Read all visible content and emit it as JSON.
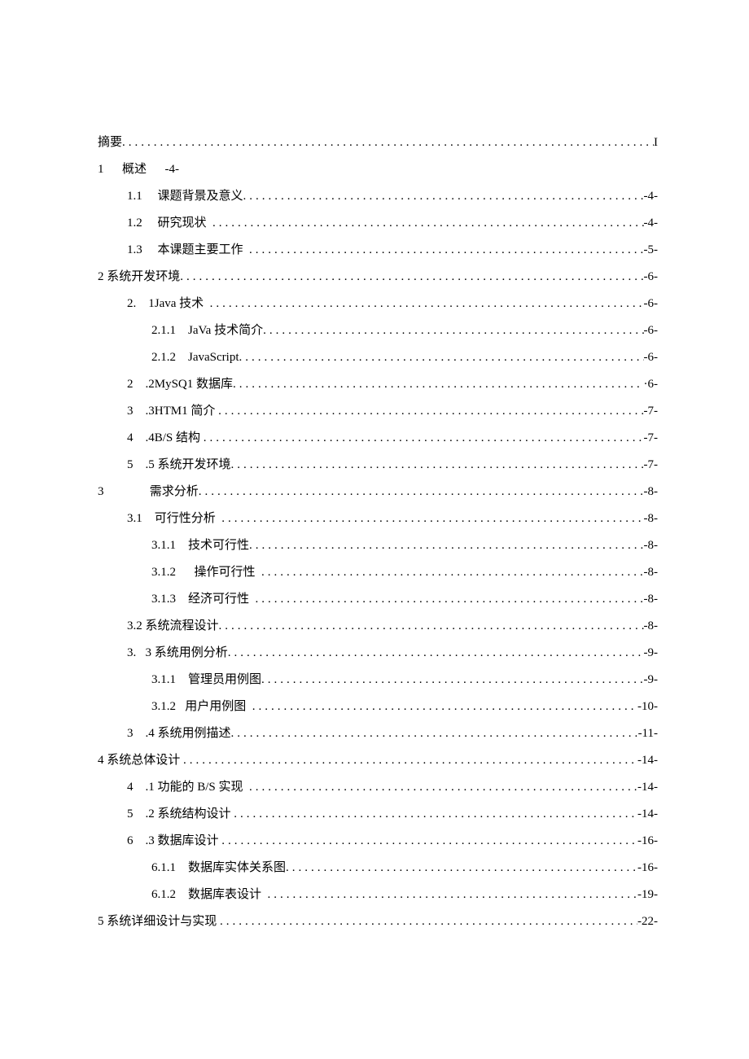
{
  "toc": [
    {
      "indent": 0,
      "label": "摘要",
      "page": "I",
      "leader": true
    },
    {
      "indent": 0,
      "label": "1      概述      -4-",
      "page": "",
      "leader": false
    },
    {
      "indent": 1,
      "label": "1.1     课题背景及意义",
      "page": "-4-",
      "leader": true
    },
    {
      "indent": 1,
      "label": "1.2     研究现状  ",
      "page": "-4-",
      "leader": true
    },
    {
      "indent": 1,
      "label": "1.3     本课题主要工作  ",
      "page": "-5-",
      "leader": true
    },
    {
      "indent": 0,
      "label": "2 系统开发环境",
      "page": "-6-",
      "leader": true
    },
    {
      "indent": 1,
      "label": "2.    1Java 技术  ",
      "page": "-6-",
      "leader": true
    },
    {
      "indent": 2,
      "label": "2.1.1    JaVa 技术简介",
      "page": "-6-",
      "leader": true
    },
    {
      "indent": 2,
      "label": "2.1.2    JavaScript",
      "page": "-6-",
      "leader": true
    },
    {
      "indent": 1,
      "label": "2    .2MySQ1 数据库",
      "page": " ·6-",
      "leader": true
    },
    {
      "indent": 1,
      "label": "3    .3HTM1 简介 ",
      "page": "-7-",
      "leader": true
    },
    {
      "indent": 1,
      "label": "4    .4B/S 结构 ",
      "page": "-7-",
      "leader": true
    },
    {
      "indent": 1,
      "label": "5    .5 系统开发环境",
      "page": "-7-",
      "leader": true
    },
    {
      "indent": 0,
      "label": "3               需求分析",
      "page": "-8-",
      "leader": true
    },
    {
      "indent": 1,
      "label": "3.1    可行性分析  ",
      "page": "-8-",
      "leader": true
    },
    {
      "indent": 2,
      "label": "3.1.1    技术可行性",
      "page": "-8-",
      "leader": true
    },
    {
      "indent": 2,
      "label": "3.1.2      操作可行性  ",
      "page": "-8-",
      "leader": true
    },
    {
      "indent": 2,
      "label": "3.1.3    经济可行性  ",
      "page": "-8-",
      "leader": true
    },
    {
      "indent": 1,
      "label": "3.2 系统流程设计",
      "page": "-8-",
      "leader": true
    },
    {
      "indent": 1,
      "label": "3.   3 系统用例分析",
      "page": "-9-",
      "leader": true
    },
    {
      "indent": 2,
      "label": "3.1.1    管理员用例图",
      "page": "-9-",
      "leader": true
    },
    {
      "indent": 2,
      "label": "3.1.2   用户用例图  ",
      "page": "-10-",
      "leader": true
    },
    {
      "indent": 1,
      "label": "3    .4 系统用例描述",
      "page": "-11-",
      "leader": true
    },
    {
      "indent": 0,
      "label": "4 系统总体设计 ",
      "page": "-14-",
      "leader": true
    },
    {
      "indent": 1,
      "label": "4    .1 功能的 B/S 实现  ",
      "page": "-14-",
      "leader": true
    },
    {
      "indent": 1,
      "label": "5    .2 系统结构设计 ",
      "page": "-14-",
      "leader": true
    },
    {
      "indent": 1,
      "label": "6    .3 数据库设计 ",
      "page": "-16-",
      "leader": true
    },
    {
      "indent": 2,
      "label": "6.1.1    数据库实体关系图",
      "page": "-16-",
      "leader": true
    },
    {
      "indent": 2,
      "label": "6.1.2    数据库表设计  ",
      "page": "-19-",
      "leader": true
    },
    {
      "indent": 0,
      "label": "5 系统详细设计与实现 ",
      "page": "-22-",
      "leader": true
    }
  ]
}
